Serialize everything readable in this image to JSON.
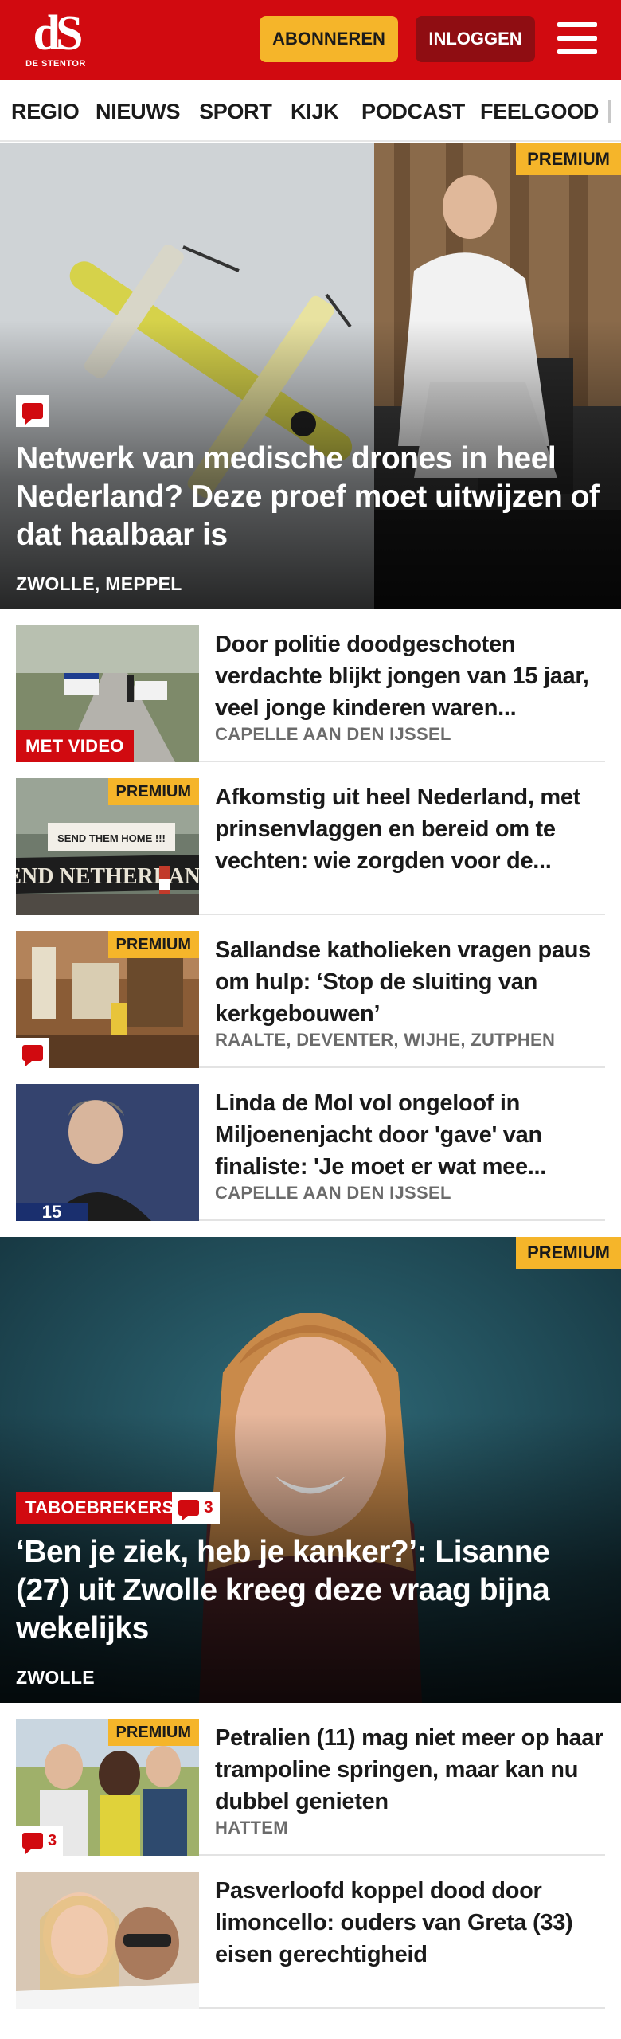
{
  "header": {
    "logo_mark": "dS",
    "logo_sub": "DE STENTOR",
    "subscribe_label": "ABONNEREN",
    "login_label": "INLOGGEN",
    "menu_icon": "hamburger-icon",
    "colors": {
      "brand": "#d10a10",
      "accent": "#f5b52a",
      "login_bg": "#8f0d12"
    }
  },
  "nav": {
    "items": [
      {
        "label": "REGIO"
      },
      {
        "label": "NIEUWS"
      },
      {
        "label": "SPORT"
      },
      {
        "label": "KIJK"
      },
      {
        "label": "PODCAST"
      },
      {
        "label": "FEELGOOD"
      }
    ]
  },
  "hero1": {
    "premium": "PREMIUM",
    "title": "Netwerk van medische drones in heel Nederland? Deze proef moet uitwijzen of dat haalbaar is",
    "location": "ZWOLLE, MEPPEL",
    "comment_icon": "comment-icon"
  },
  "list1": [
    {
      "title": "Door politie doodgeschoten verdachte blijkt jongen van 15 jaar, veel jonge kinderen waren...",
      "location": "CAPELLE AAN DEN IJSSEL",
      "label": "MET VIDEO"
    },
    {
      "title": "Afkomstig uit heel Nederland, met prinsenvlaggen en bereid om te vechten: wie zorgden voor de...",
      "location": "",
      "premium": "PREMIUM",
      "sign_text": "DEFEND NETHERLANDS",
      "banner_text": "SEND THEM HOME !!!"
    },
    {
      "title": "Sallandse katholieken vragen paus om hulp: ‘Stop de sluiting van kerkgebouwen’",
      "location": "RAALTE, DEVENTER, WIJHE, ZUTPHEN",
      "premium": "PREMIUM",
      "has_comment": true
    },
    {
      "title": "Linda de Mol vol ongeloof in Miljoenenjacht door 'gave' van finaliste: 'Je moet er wat mee...",
      "location": "CAPELLE AAN DEN IJSSEL",
      "screen_number": "15"
    }
  ],
  "hero2": {
    "premium": "PREMIUM",
    "category": "TABOEBREKERS",
    "comments": "3",
    "title": "‘Ben je ziek, heb je kanker?’: Lisanne (27) uit Zwolle kreeg deze vraag bijna wekelijks",
    "location": "ZWOLLE"
  },
  "list2": [
    {
      "title": "Petralien (11) mag niet meer op haar trampoline springen, maar kan nu dubbel genieten",
      "location": "HATTEM",
      "premium": "PREMIUM",
      "comments": "3"
    },
    {
      "title": "Pasverloofd koppel dood door limoncello: ouders van Greta (33) eisen gerechtigheid",
      "location": ""
    }
  ]
}
